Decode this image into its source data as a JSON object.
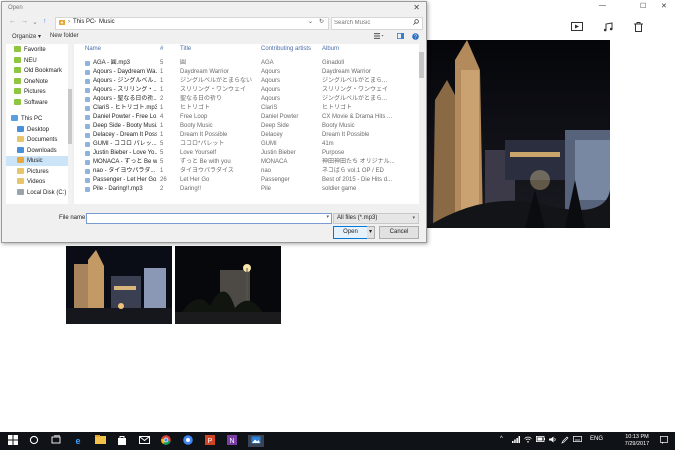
{
  "dialog": {
    "title": "Open",
    "close_glyph": "✕",
    "nav": {
      "back": "←",
      "forward": "→",
      "down": "⌄",
      "up": "↑"
    },
    "address": {
      "root": "This PC",
      "sep": "›",
      "folder": "Music",
      "chev": "⌄",
      "refresh": "↻"
    },
    "search": {
      "placeholder": "Search Music",
      "icon": "search-icon"
    },
    "commands": {
      "organize": "Organize ▾",
      "new_folder": "New folder"
    },
    "columns": {
      "name": "Name",
      "num": "#",
      "title": "Title",
      "artists": "Contributing artists",
      "album": "Album"
    },
    "nav_items": [
      {
        "label": "Favorite",
        "color": "#8dc63f"
      },
      {
        "label": "NEU",
        "color": "#8dc63f"
      },
      {
        "label": "Old Bookmark",
        "color": "#8dc63f"
      },
      {
        "label": "OneNote",
        "color": "#8dc63f"
      },
      {
        "label": "Pictures",
        "color": "#8dc63f"
      },
      {
        "label": "Software",
        "color": "#8dc63f"
      },
      {
        "label": "This PC",
        "color": "#5aa0e0"
      },
      {
        "label": "Desktop",
        "color": "#4a90d9"
      },
      {
        "label": "Documents",
        "color": "#e8c46a"
      },
      {
        "label": "Downloads",
        "color": "#4a90d9"
      },
      {
        "label": "Music",
        "color": "#e8a93a"
      },
      {
        "label": "Pictures",
        "color": "#e8c46a"
      },
      {
        "label": "Videos",
        "color": "#e8c46a"
      },
      {
        "label": "Local Disk (C:)",
        "color": "#9aa4ad"
      }
    ],
    "files": [
      {
        "name": "AGA - 圓.mp3",
        "num": "5",
        "title": "圓",
        "artist": "AGA",
        "album": "Ginadoll"
      },
      {
        "name": "Aqours - Daydream Wa...",
        "num": "1",
        "title": "Daydream Warrior",
        "artist": "Aqours",
        "album": "Daydream Warrior"
      },
      {
        "name": "Aqours - ジングルベル...",
        "num": "1",
        "title": "ジングルベルがとまらない",
        "artist": "Aqours",
        "album": "ジングルベルがとまら..."
      },
      {
        "name": "Aqours - スリリング・...",
        "num": "1",
        "title": "スリリング・ワンウェイ",
        "artist": "Aqours",
        "album": "スリリング・ワンウェイ"
      },
      {
        "name": "Aqours - 聖なる日の祈...",
        "num": "2",
        "title": "聖なる日の祈り",
        "artist": "Aqours",
        "album": "ジングルベルがとまら..."
      },
      {
        "name": "ClariS - ヒトリゴト.mp3",
        "num": "1",
        "title": "ヒトリゴト",
        "artist": "ClariS",
        "album": "ヒトリゴト"
      },
      {
        "name": "Daniel Powter - Free Lo...",
        "num": "4",
        "title": "Free Loop",
        "artist": "Daniel Powter",
        "album": "CX Movie & Drama Hits ..."
      },
      {
        "name": "Deep Side - Booty Musi...",
        "num": "1",
        "title": "Booty Music",
        "artist": "Deep Side",
        "album": "Booty Music"
      },
      {
        "name": "Delacey - Dream It Poss...",
        "num": "1",
        "title": "Dream It Possible",
        "artist": "Delacey",
        "album": "Dream It Possible"
      },
      {
        "name": "GUMI - ココロ パレッ...",
        "num": "5",
        "title": "ココロ*パレット",
        "artist": "GUMI",
        "album": "41m"
      },
      {
        "name": "Justin Bieber - Love Yo...",
        "num": "5",
        "title": "Love Yourself",
        "artist": "Justin Bieber",
        "album": "Purpose"
      },
      {
        "name": "MONACA - ずっと Be wi...",
        "num": "5",
        "title": "ずっと Be with you",
        "artist": "MONACA",
        "album": "神田神田たち オリジナル..."
      },
      {
        "name": "nao - タイヨウパラダ...",
        "num": "1",
        "title": "タイヨウパラダイス",
        "artist": "nao",
        "album": "ネコばら vol.1 OP / ED"
      },
      {
        "name": "Passenger - Let Her Go...",
        "num": "26",
        "title": "Let Her Go",
        "artist": "Passenger",
        "album": "Best of 2015 - Die Hits d..."
      },
      {
        "name": "Pile - Daring!!.mp3",
        "num": "2",
        "title": "Daring!!",
        "artist": "Pile",
        "album": "soldier game"
      }
    ],
    "file_name_label": "File name:",
    "file_name_value": "",
    "file_type": "All files (*.mp3)",
    "open_label": "Open",
    "cancel_label": "Cancel"
  },
  "window": {
    "minimize": "—",
    "maximize": "☐",
    "close": "✕"
  },
  "toolbar_icons": [
    "slideshow-icon",
    "music-note-icon",
    "delete-icon"
  ],
  "taskbar": {
    "apps": [
      "windows-start-icon",
      "cortana-icon",
      "task-view-icon",
      "edge-icon",
      "file-explorer-icon",
      "store-icon",
      "mail-icon",
      "chrome-icon",
      "powerpoint-icon",
      "onenote-icon",
      "photos-icon"
    ],
    "language": "ENG",
    "time": "10:13 PM",
    "date": "7/29/2017"
  }
}
